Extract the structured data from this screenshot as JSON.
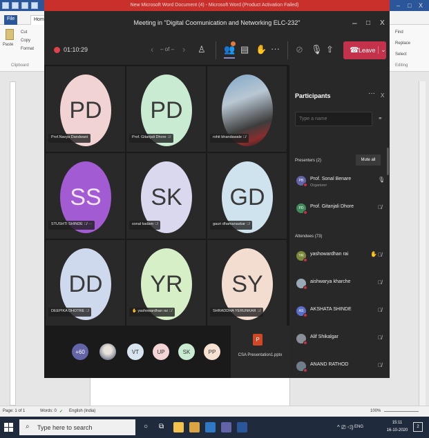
{
  "word": {
    "title": "New Microsoft Word Document (4) - Microsoft Word (Product Activation Failed)",
    "tab_file": "File",
    "tab_home": "Home",
    "ribbon": {
      "cut": "Cut",
      "copy": "Copy",
      "paste": "Paste",
      "format": "Format",
      "clipboard": "Clipboard",
      "find": "Find",
      "replace": "Replace",
      "select": "Select",
      "editing": "Editing"
    },
    "win_controls": [
      "–",
      "□",
      "X"
    ],
    "status": {
      "page": "Page: 1 of 1",
      "words": "Words: 0",
      "language": "English (India)",
      "zoom": "100%"
    }
  },
  "teams": {
    "title": "Meeting in \"Digital Coomunication and Networking ELC-232\"",
    "win_controls": [
      "–",
      "□",
      "X"
    ],
    "timer": "01:10:29",
    "page_indicator": "– of –",
    "leave_label": "Leave",
    "tiles": [
      {
        "initials": "PD",
        "name": "Prof.Navya Dandwani",
        "color": "#f2d3d3",
        "muted": false
      },
      {
        "initials": "PD",
        "name": "Prof. Gitanjali Dhore",
        "color": "#c9ebd2",
        "muted": true
      },
      {
        "initials": "",
        "name": "rohit bhandawale",
        "color": "#5c6b7a",
        "muted": true
      },
      {
        "initials": "SS",
        "name": "STUSHTI SHINDE",
        "color": "#a35bd4",
        "muted": true
      },
      {
        "initials": "SK",
        "name": "sonal kadam",
        "color": "#d9d8ef",
        "muted": true
      },
      {
        "initials": "GD",
        "name": "gauri dhamanaskar",
        "color": "#cfe3ef",
        "muted": true
      },
      {
        "initials": "DD",
        "name": "DEEPIKA DHOTRE",
        "color": "#cfd9ee",
        "muted": true
      },
      {
        "initials": "YR",
        "name": "yashowardhan rai",
        "color": "#d6efc7",
        "muted": true
      },
      {
        "initials": "SY",
        "name": "SHRADDHA YERUNKAR",
        "color": "#f2ddd0",
        "muted": true
      }
    ],
    "tile_more_glyph": "···",
    "overflow": {
      "count": "+60",
      "avatars": [
        {
          "initials": "",
          "color": "#cdd8e2"
        },
        {
          "initials": "VT",
          "color": "#d8e4ef"
        },
        {
          "initials": "UP",
          "color": "#f4d4d4"
        },
        {
          "initials": "SK",
          "color": "#c9ebd2"
        },
        {
          "initials": "PP",
          "color": "#f6e1d2"
        }
      ]
    },
    "presentation": {
      "icon_letter": "P",
      "file": "CSA Presentation1.pptx"
    }
  },
  "participants": {
    "title": "Participants",
    "more_glyph": "···",
    "close_glyph": "X",
    "search_placeholder": "Type a name",
    "presenters_header": "Presenters (2)",
    "mute_all": "Mute all",
    "presenters": [
      {
        "initials": "PB",
        "name": "Prof. Sonal Benare",
        "sub": "Organizer",
        "color": "#6264a7",
        "mic": "on"
      },
      {
        "initials": "PD",
        "name": "Prof. Gitanjali Dhore",
        "sub": "",
        "color": "#3f8a5a",
        "mic": "off"
      }
    ],
    "attendees_header": "Attendees (73)",
    "attendees": [
      {
        "initials": "YR",
        "name": "yashowardhan rai",
        "color": "#7a8a3a",
        "hand": true
      },
      {
        "initials": "",
        "name": "aishwarya kharche",
        "color": "#9aa9b8",
        "hand": false
      },
      {
        "initials": "AS",
        "name": "AKSHATA SHINDE",
        "color": "#5b6fc9",
        "hand": false
      },
      {
        "initials": "",
        "name": "Alif Shikalgar",
        "color": "#8a8f99",
        "hand": false
      },
      {
        "initials": "",
        "name": "ANAND RATHOD",
        "color": "#6f7e8a",
        "hand": false
      }
    ]
  },
  "taskbar": {
    "search_placeholder": "Type here to search",
    "language": "ENG",
    "time": "15:11",
    "date": "16-10-2020",
    "notification_count": "2"
  },
  "colors": {
    "teams_bg": "#201f1f",
    "leave_red": "#c4314b",
    "word_blue": "#2b579a",
    "taskbar": "#1f2a3c"
  }
}
